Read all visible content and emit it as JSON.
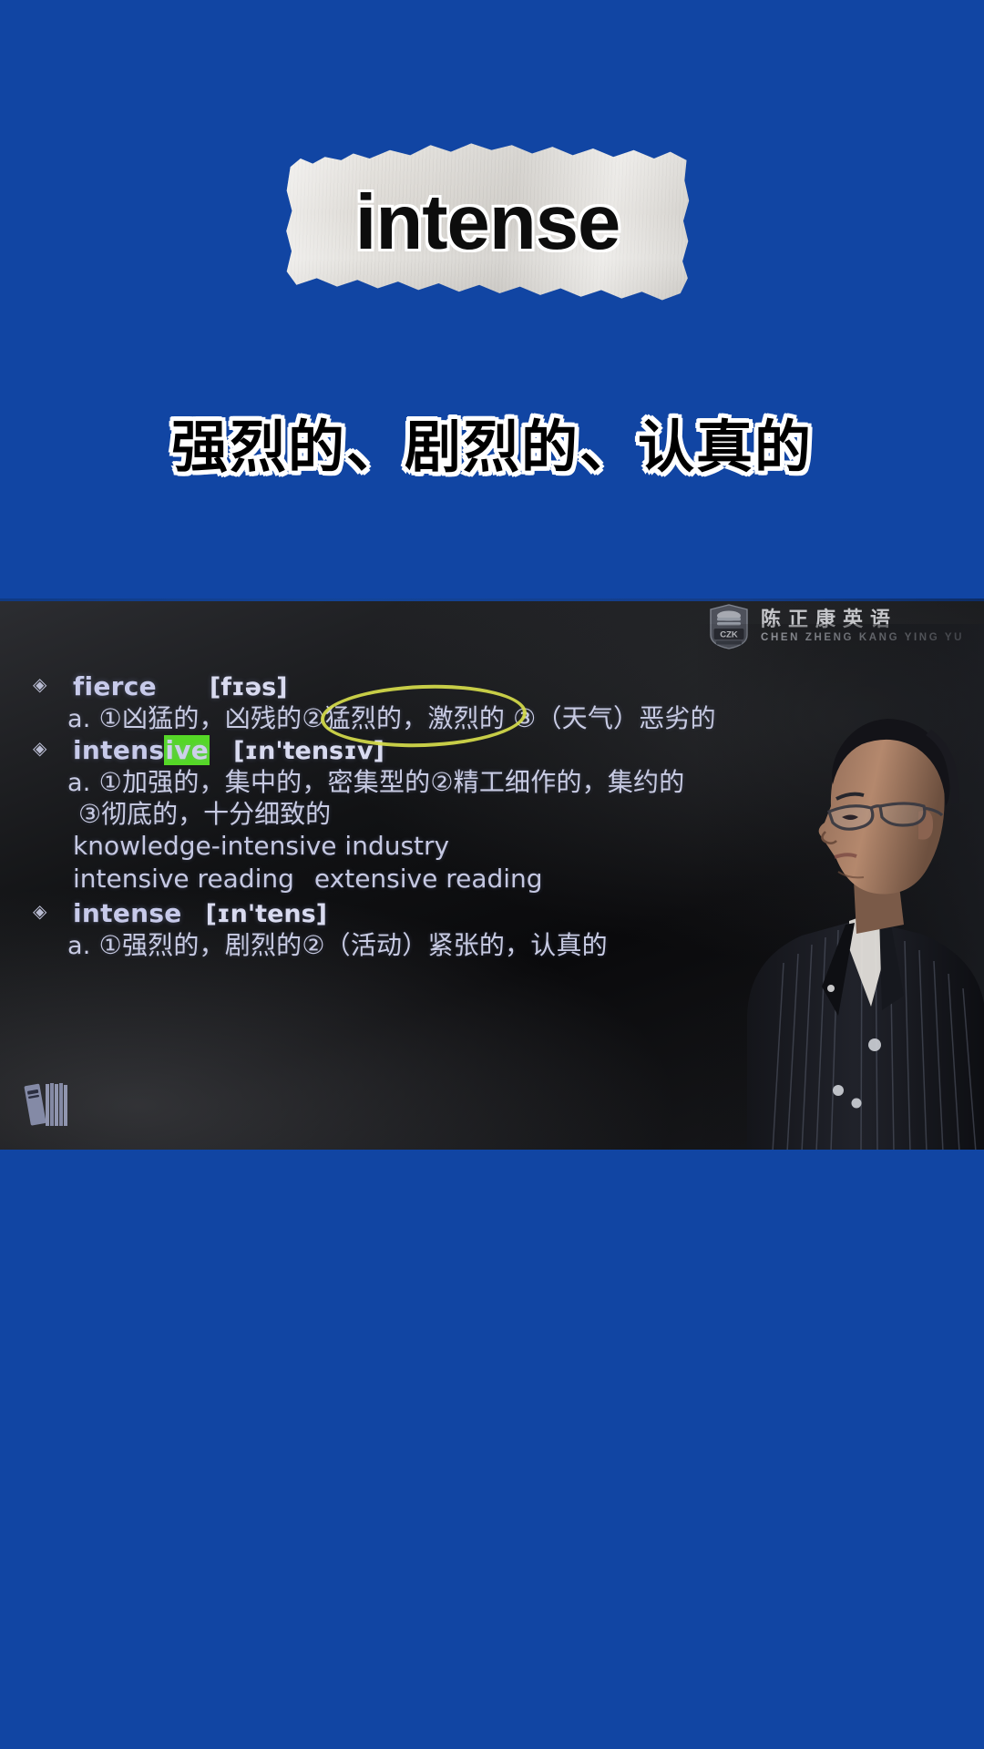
{
  "theme": {
    "background_blue": "#1145a3",
    "paper": "#e2dfda",
    "highlight_green": "#55d826",
    "circle_yellow": "#d6dc4b",
    "board_text": "#c8cbe3"
  },
  "title_card": {
    "headword": "intense"
  },
  "subtitle": {
    "text": "强烈的、剧烈的、认真的"
  },
  "video": {
    "watermark": {
      "badge_text": "CZK",
      "chinese": "陈正康英语",
      "pinyin": "CHEN ZHENG KANG YING YU"
    },
    "board": {
      "entries": [
        {
          "bullet": "◈",
          "word": "fierce",
          "ipa": "[fɪəs]",
          "definition_label": "a.",
          "definition": "①凶猛的，凶残的②猛烈的，激烈的 ③（天气）恶劣的"
        },
        {
          "bullet": "◈",
          "word_plain": "intens",
          "word_highlight": "ive",
          "ipa": "[ɪn'tensɪv]",
          "definition_label": "a.",
          "definition": "①加强的，集中的，密集型的②精工细作的，集约的",
          "definition_cont": "③彻底的，十分细致的",
          "phrases": [
            "knowledge-intensive industry",
            "intensive reading",
            "extensive reading"
          ]
        },
        {
          "bullet": "◈",
          "word": "intense",
          "ipa": "[ɪn'tens]",
          "definition_label": "a.",
          "definition": "①强烈的，剧烈的②（活动）紧张的，认真的"
        }
      ],
      "annotation": "yellow-circle-around-猛烈的"
    },
    "icons": {
      "books": "books-icon",
      "presenter": "presenter-figure"
    }
  }
}
